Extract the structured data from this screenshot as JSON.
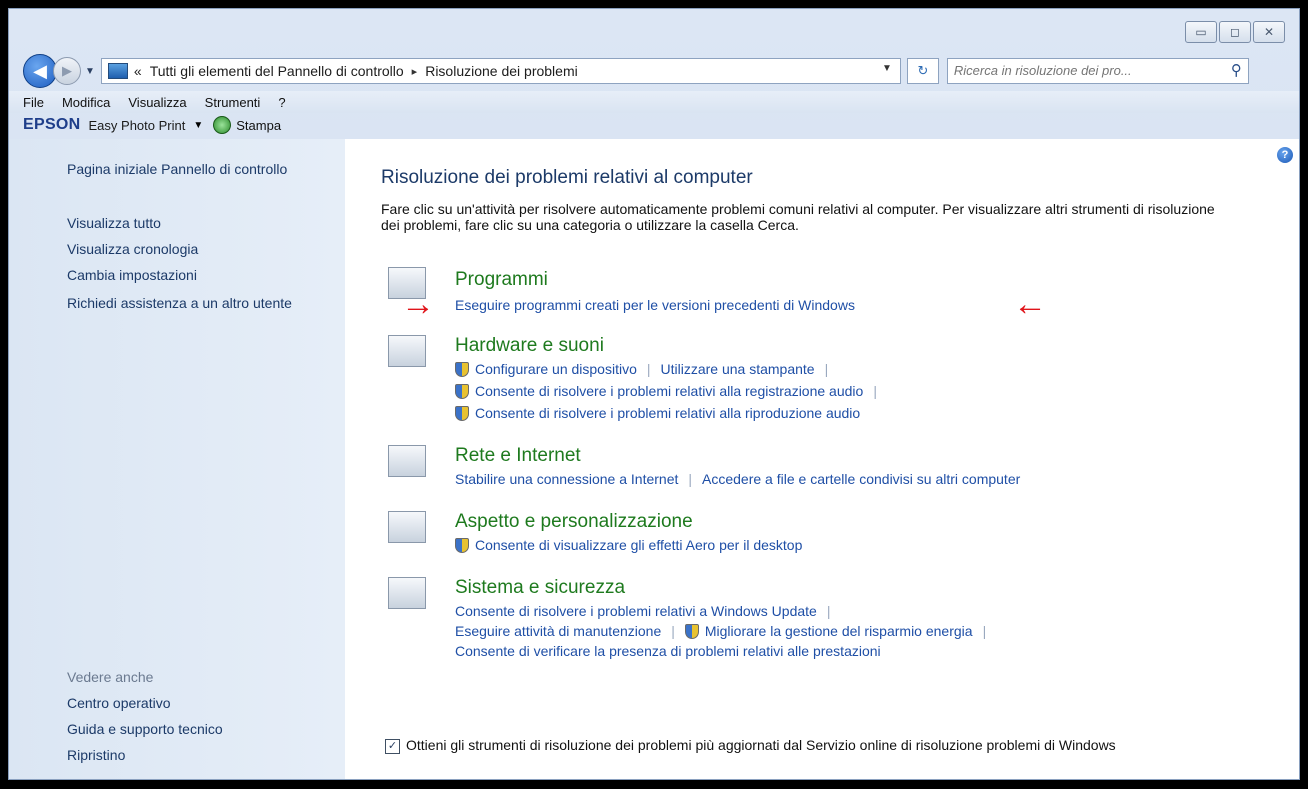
{
  "window": {
    "buttons": [
      "▭",
      "◻",
      "✕"
    ]
  },
  "address": {
    "prefix": "«",
    "crumb1": "Tutti gli elementi del Pannello di controllo",
    "sep": "▸",
    "crumb2": "Risoluzione dei problemi"
  },
  "search": {
    "placeholder": "Ricerca in risoluzione dei pro..."
  },
  "menu": [
    "File",
    "Modifica",
    "Visualizza",
    "Strumenti",
    "?"
  ],
  "epson": {
    "brand": "EPSON",
    "app": "Easy Photo Print",
    "stamp": "Stampa"
  },
  "sidebar": {
    "items": [
      "Pagina iniziale Pannello di controllo",
      "Visualizza tutto",
      "Visualizza cronologia",
      "Cambia impostazioni",
      "Richiedi assistenza a un altro utente"
    ],
    "see_also_title": "Vedere anche",
    "see_also": [
      "Centro operativo",
      "Guida e supporto tecnico",
      "Ripristino"
    ]
  },
  "main": {
    "title": "Risoluzione dei problemi relativi al computer",
    "intro": "Fare clic su un'attività per risolvere automaticamente problemi comuni relativi al computer. Per visualizzare altri strumenti di risoluzione dei problemi, fare clic su una categoria o utilizzare la casella Cerca.",
    "categories": {
      "programs": {
        "title": "Programmi",
        "link1": "Eseguire programmi creati per le versioni precedenti di Windows"
      },
      "hardware": {
        "title": "Hardware e suoni",
        "link1": "Configurare un dispositivo",
        "link2": "Utilizzare una stampante",
        "link3": "Consente di risolvere i problemi relativi alla registrazione audio",
        "link4": "Consente di risolvere i problemi relativi alla riproduzione audio"
      },
      "network": {
        "title": "Rete e Internet",
        "link1": "Stabilire una connessione a Internet",
        "link2": "Accedere a file e cartelle condivisi su altri computer"
      },
      "appearance": {
        "title": "Aspetto e personalizzazione",
        "link1": "Consente di visualizzare gli effetti Aero per il desktop"
      },
      "system": {
        "title": "Sistema e sicurezza",
        "link1": "Consente di risolvere i problemi relativi a Windows Update",
        "link2": "Eseguire attività di manutenzione",
        "link3": "Migliorare la gestione del risparmio energia",
        "link4": "Consente di verificare la presenza di problemi relativi alle prestazioni"
      }
    },
    "checkbox_label": "Ottieni gli strumenti di risoluzione dei problemi più aggiornati dal Servizio online di risoluzione problemi di Windows",
    "checkbox_checked": true
  },
  "colors": {
    "category_title": "#1e7a1e",
    "link": "#1f4fa6",
    "arrow": "#e0141a"
  }
}
